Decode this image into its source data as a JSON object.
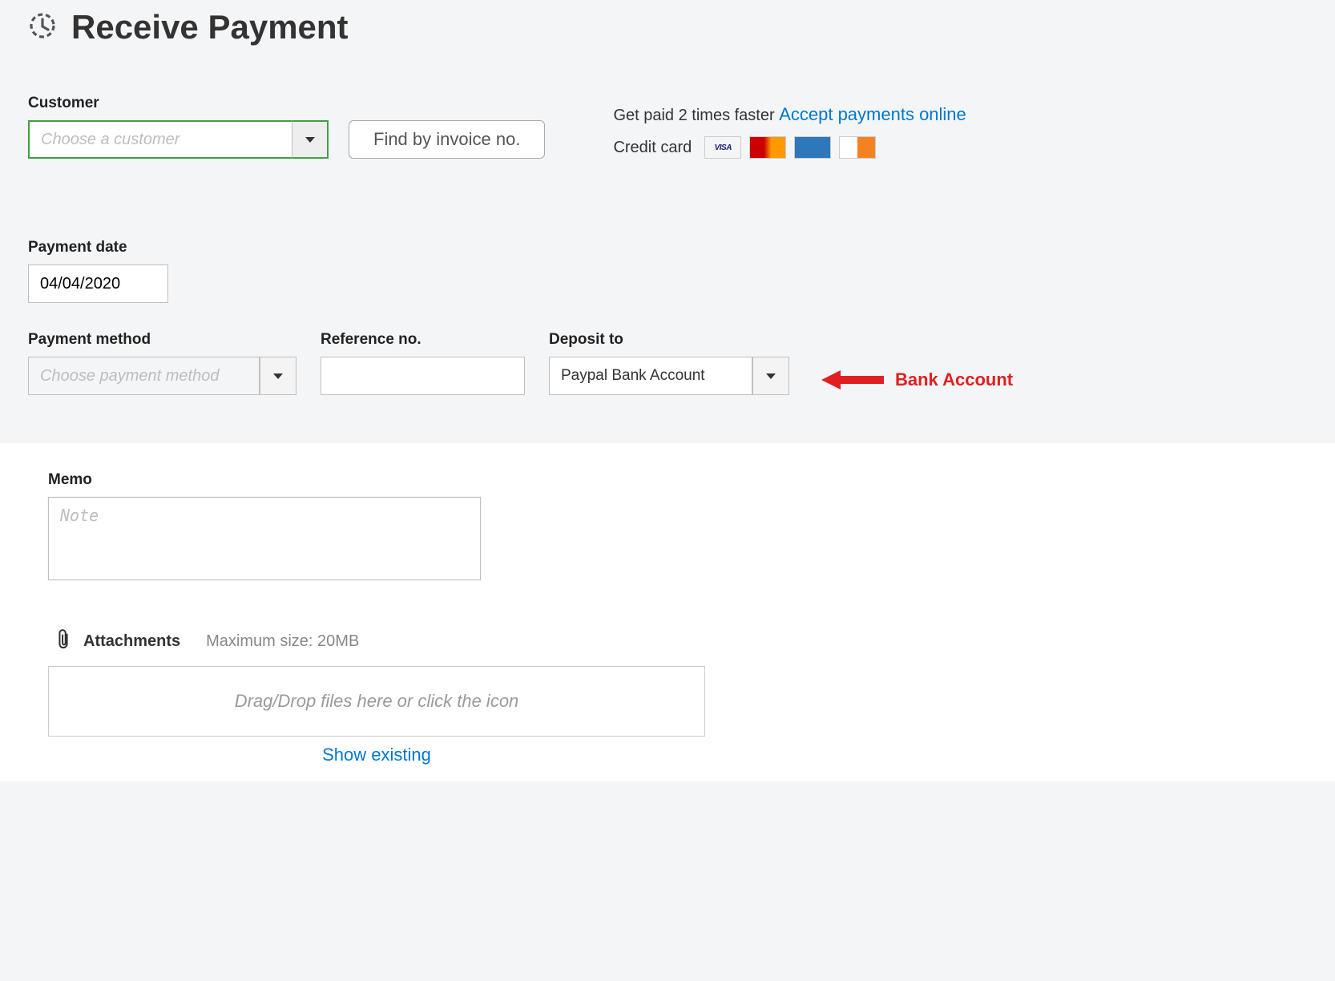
{
  "header": {
    "title": "Receive Payment"
  },
  "customer": {
    "label": "Customer",
    "placeholder": "Choose a customer",
    "find_button": "Find by invoice no."
  },
  "promo": {
    "lead": "Get paid 2 times faster",
    "link": "Accept payments online",
    "cc_label": "Credit card"
  },
  "payment_date": {
    "label": "Payment date",
    "value": "04/04/2020"
  },
  "payment_method": {
    "label": "Payment method",
    "placeholder": "Choose payment method"
  },
  "reference": {
    "label": "Reference no.",
    "value": ""
  },
  "deposit": {
    "label": "Deposit to",
    "value": "Paypal Bank Account"
  },
  "annotation": {
    "text": "Bank Account"
  },
  "memo": {
    "label": "Memo",
    "placeholder": "Note"
  },
  "attachments": {
    "label": "Attachments",
    "hint": "Maximum size: 20MB",
    "dropzone": "Drag/Drop files here or click the icon",
    "show_existing": "Show existing"
  }
}
